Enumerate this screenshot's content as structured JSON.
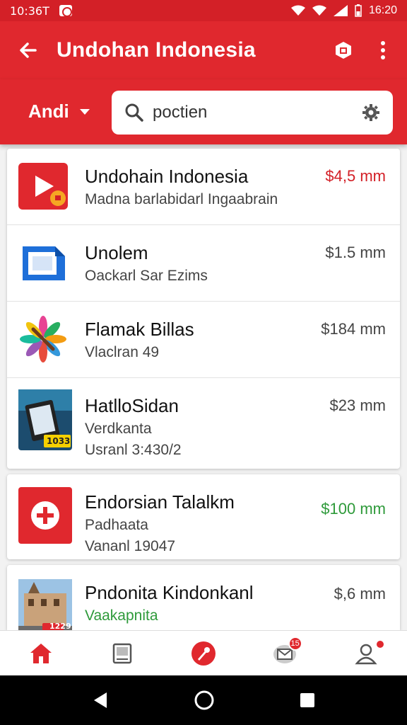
{
  "status_bar": {
    "time": "10:36T",
    "clock": "16:20"
  },
  "app_bar": {
    "title": "Undohan Indonesia"
  },
  "search": {
    "user": "Andi",
    "query": "poctien"
  },
  "list_card1": [
    {
      "title": "Undohain Indonesia",
      "subtitle": "Madna barlabidarl Ingaabrain",
      "price": "$4,5 mm",
      "price_color": "#d32027",
      "icon": "youtube-icon"
    },
    {
      "title": "Unolem",
      "subtitle": "Oackarl Sar Ezims",
      "price": "$1.5 mm",
      "icon": "document-icon"
    },
    {
      "title": "Flamak Billas",
      "subtitle": "Vlaclran 49",
      "price": "$184 mm",
      "icon": "pinwheel-icon"
    },
    {
      "title": "HatlloSidan",
      "subtitle": "Verdkanta",
      "subtitle2": "Usranl 3:430/2",
      "price": "$23 mm",
      "badge": "1033",
      "icon": "tablet-photo"
    }
  ],
  "list_card2": [
    {
      "title": "Endorsian Talalkm",
      "subtitle": "Padhaata",
      "subtitle2": "Vananl 19047",
      "price": "$100 mm",
      "price_color": "#2e9a3a",
      "icon": "plus-icon"
    }
  ],
  "list_card3": [
    {
      "title": "Pndonita Kindonkanl",
      "subtitle": "Vaakapnita",
      "price": "$,6 mm",
      "badge": "1229",
      "icon": "building-photo"
    }
  ],
  "bottom_nav": {
    "badge_count": "15"
  },
  "colors": {
    "brand_red": "#e0282e",
    "price_red": "#d32027",
    "price_green": "#2e9a3a"
  }
}
